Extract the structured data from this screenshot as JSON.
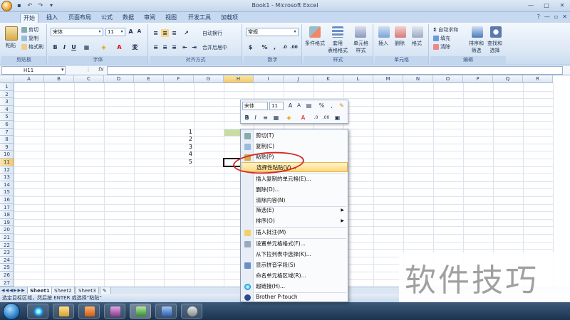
{
  "window": {
    "title": "Book1 - Microsoft Excel"
  },
  "tabs": [
    "开始",
    "插入",
    "页面布局",
    "公式",
    "数据",
    "审阅",
    "视图",
    "开发工具",
    "加载项"
  ],
  "ribbon": {
    "clipboard": {
      "paste": "粘贴",
      "cut": "剪切",
      "copy": "复制",
      "format_painter": "格式刷",
      "label": "剪贴板"
    },
    "font": {
      "font_name": "宋体",
      "font_size": "11",
      "label": "字体"
    },
    "alignment": {
      "wrap": "自动换行",
      "merge": "合并后居中",
      "label": "对齐方式"
    },
    "number": {
      "format": "常规",
      "label": "数字"
    },
    "styles": {
      "conditional": "条件格式",
      "table": "套用\n表格格式",
      "cell": "单元格\n样式",
      "label": "样式"
    },
    "cells": {
      "insert": "插入",
      "delete": "删除",
      "format": "格式",
      "label": "单元格"
    },
    "editing": {
      "autosum": "自动求和",
      "fill": "填充",
      "clear": "清除",
      "sort": "排序和\n筛选",
      "find": "查找和\n选择",
      "label": "编辑"
    }
  },
  "formula_bar": {
    "name_box": "H11",
    "fx": "fx",
    "content": ""
  },
  "grid": {
    "columns": [
      "A",
      "B",
      "C",
      "D",
      "E",
      "F",
      "G",
      "H",
      "I",
      "J",
      "K",
      "L",
      "M",
      "N",
      "O",
      "P",
      "Q",
      "R"
    ],
    "rows": [
      "1",
      "2",
      "3",
      "4",
      "5",
      "6",
      "7",
      "8",
      "9",
      "10",
      "11",
      "12",
      "13",
      "14",
      "15",
      "16",
      "17",
      "18",
      "19",
      "20",
      "21",
      "22",
      "23",
      "24",
      "25",
      "26",
      "27"
    ],
    "values": [
      "1",
      "2",
      "3",
      "4",
      "5"
    ]
  },
  "sheets": [
    "Sheet1",
    "Sheet2",
    "Sheet3"
  ],
  "status_text": "选定目标区域，然后按 ENTER 或选择“粘贴”",
  "mini_toolbar": {
    "font": "宋体",
    "size": "11"
  },
  "context_menu": [
    {
      "label": "剪切(T)"
    },
    {
      "label": "复制(C)"
    },
    {
      "label": "粘贴(P)"
    },
    {
      "label": "选择性粘贴(V)..."
    },
    {
      "label": "插入复制的单元格(E)..."
    },
    {
      "label": "删除(D)..."
    },
    {
      "label": "清除内容(N)"
    },
    {
      "label": "筛选(E)"
    },
    {
      "label": "排序(O)"
    },
    {
      "label": "插入批注(M)"
    },
    {
      "label": "设置单元格格式(F)..."
    },
    {
      "label": "从下拉列表中选择(K)..."
    },
    {
      "label": "显示拼音字段(S)"
    },
    {
      "label": "命名单元格区域(R)..."
    },
    {
      "label": "超链接(H)..."
    },
    {
      "label": "Brother P-touch"
    }
  ],
  "watermark": "软件技巧",
  "colors": {
    "highlight": "#ffd97a",
    "annotation": "#d42a2a",
    "selected_header": "#f5c867"
  }
}
